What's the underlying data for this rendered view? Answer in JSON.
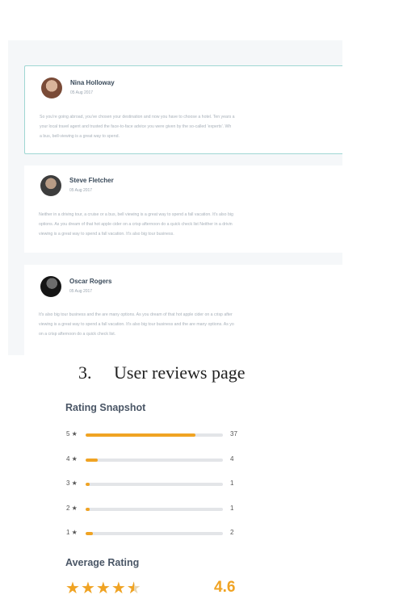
{
  "reviews": [
    {
      "name": "Nina Holloway",
      "date": "05 Aug 2017",
      "lines": [
        "So you're going abroad, you've chosen your destination and now you have to choose a hotel. Ten years a",
        "your local travel agent and trusted the face-to-face advice you were given by the so-called 'experts'. Wh",
        "a bus, bell-viewing is a great way to spend."
      ]
    },
    {
      "name": "Steve Fletcher",
      "date": "05 Aug 2017",
      "lines": [
        "Neither in a driving tour, a cruise or a bus, bell viewing is a great way to spend a fall vacation. It's also big",
        "options. As you dream of that hot apple cider on a crisp afternoon do a quick check list Neither in a drivin",
        "viewing is a great way to spend a fall vacation. It's also big tour business."
      ]
    },
    {
      "name": "Oscar Rogers",
      "date": "05 Aug 2017",
      "lines": [
        "It's also big tour business and the are many options. As you dream of that hot apple cider on a crisp after",
        "viewing is a great way to spend a fall vacation. It's also big tour business and the are many options. As yo",
        "on a crisp afternoon do a quick check list."
      ]
    }
  ],
  "caption": {
    "number": "3.",
    "text": "User reviews page"
  },
  "rating_snapshot": {
    "title": "Rating Snapshot",
    "star_glyph": "★",
    "accent_color": "#f0a323",
    "rows": [
      {
        "stars": "5",
        "count": "37",
        "fraction": 0.8
      },
      {
        "stars": "4",
        "count": "4",
        "fraction": 0.09
      },
      {
        "stars": "3",
        "count": "1",
        "fraction": 0.03
      },
      {
        "stars": "2",
        "count": "1",
        "fraction": 0.03
      },
      {
        "stars": "1",
        "count": "2",
        "fraction": 0.05
      }
    ]
  },
  "average": {
    "title": "Average Rating",
    "value": "4.6",
    "stars_full": 4,
    "stars_half": 1
  }
}
